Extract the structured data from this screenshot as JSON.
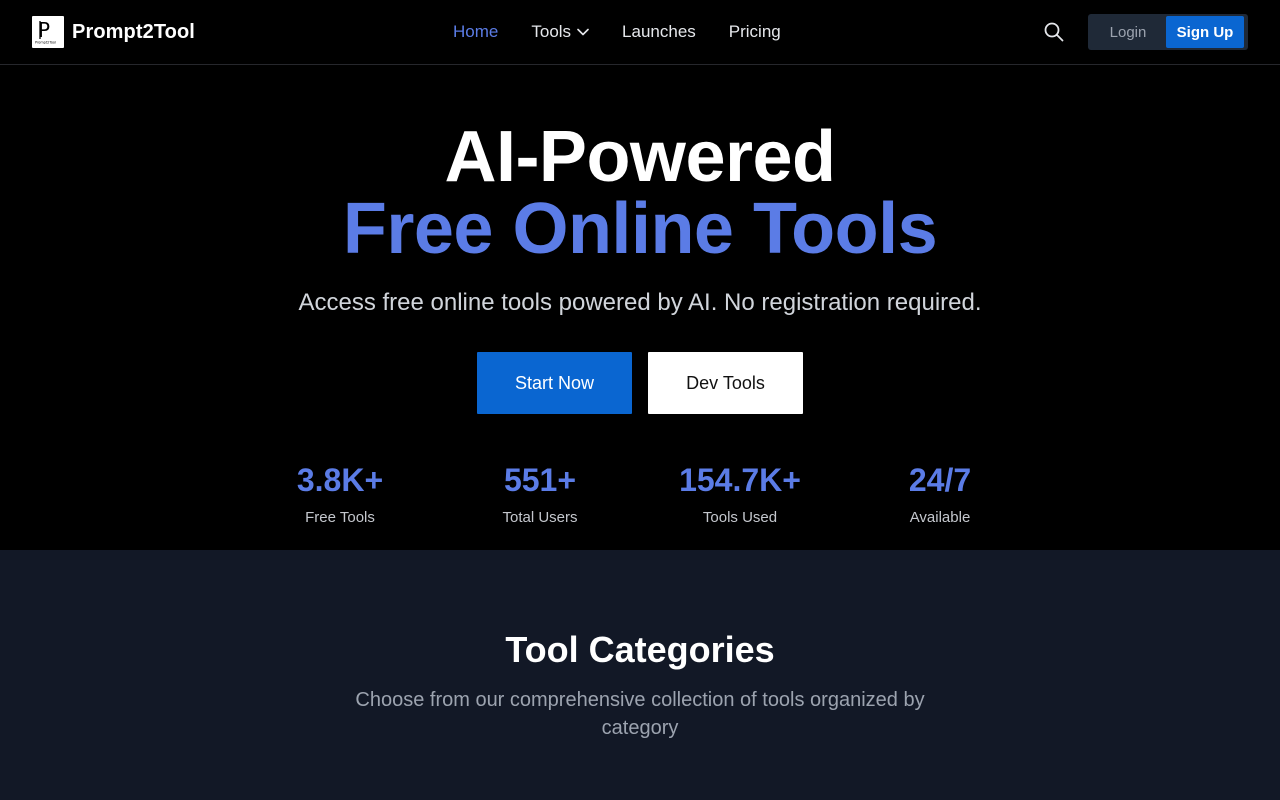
{
  "brand": {
    "name": "Prompt2Tool",
    "logo_letter": "P",
    "logo_caption": "Prompt2Tool",
    "logo_icon": "logo-icon"
  },
  "nav": {
    "items": [
      {
        "label": "Home",
        "active": true
      },
      {
        "label": "Tools",
        "has_dropdown": true
      },
      {
        "label": "Launches"
      },
      {
        "label": "Pricing"
      }
    ],
    "search_icon": "search-icon",
    "login_label": "Login",
    "signup_label": "Sign Up"
  },
  "hero": {
    "title_line1": "AI-Powered",
    "title_line2": "Free Online Tools",
    "subtitle": "Access free online tools powered by AI. No registration required.",
    "primary_cta": "Start Now",
    "secondary_cta": "Dev Tools",
    "stats": [
      {
        "value": "3.8K+",
        "label": "Free Tools"
      },
      {
        "value": "551+",
        "label": "Total Users"
      },
      {
        "value": "154.7K+",
        "label": "Tools Used"
      },
      {
        "value": "24/7",
        "label": "Available"
      }
    ]
  },
  "categories": {
    "title": "Tool Categories",
    "subtitle": "Choose from our comprehensive collection of tools organized by category"
  },
  "colors": {
    "accent": "#5b7ce6",
    "primary_button": "#0a66d1",
    "background": "#000000",
    "section_background": "#121826"
  }
}
